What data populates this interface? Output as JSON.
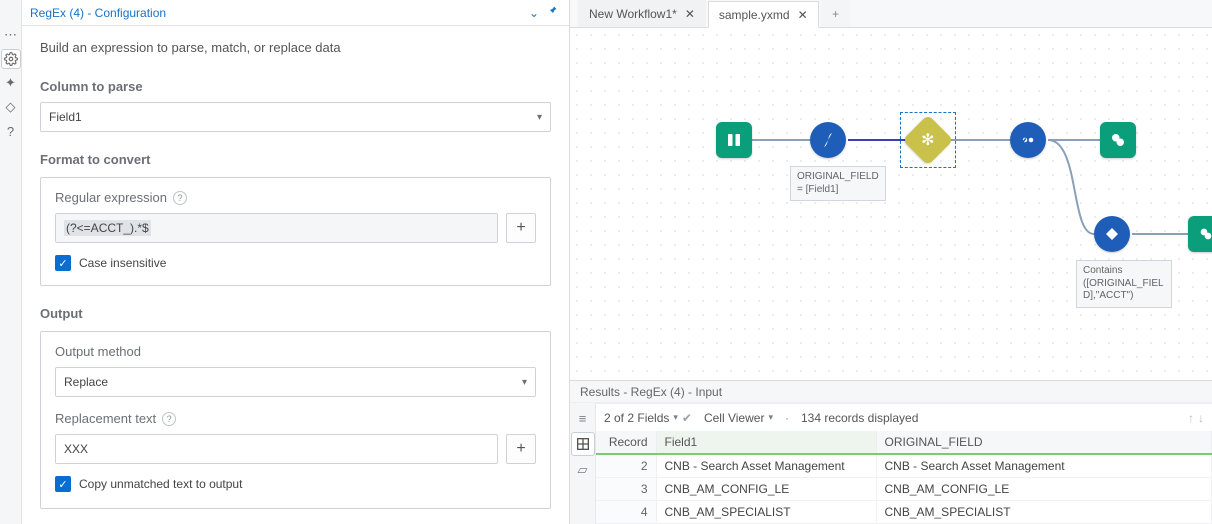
{
  "header": {
    "title": "RegEx (4) - Configuration"
  },
  "lead": "Build an expression to parse, match, or replace data",
  "column_to_parse": {
    "label": "Column to parse",
    "value": "Field1"
  },
  "format_to_convert": {
    "label": "Format to convert"
  },
  "regex": {
    "label": "Regular expression",
    "value": "(?<=ACCT_).*$"
  },
  "case": {
    "label": "Case insensitive",
    "checked": true
  },
  "output_section": {
    "label": "Output"
  },
  "output_method": {
    "label": "Output method",
    "value": "Replace"
  },
  "replacement": {
    "label": "Replacement text",
    "value": "XXX"
  },
  "copy_unmatched": {
    "label": "Copy unmatched text to output",
    "checked": true
  },
  "tabs": {
    "new": "New Workflow1*",
    "sample": "sample.yxmd"
  },
  "canvas": {
    "anno1_line1": "ORIGINAL_FIELD",
    "anno1_line2": "= [Field1]",
    "anno2_line1": "Contains",
    "anno2_line2": "([ORIGINAL_FIEL",
    "anno2_line3": "D],\"ACCT\")"
  },
  "results": {
    "title": "Results - RegEx (4) - Input",
    "fields_summary": "2 of 2 Fields",
    "cell_viewer": "Cell Viewer",
    "records_summary": "134 records displayed",
    "columns": {
      "record": "Record",
      "field1": "Field1",
      "orig": "ORIGINAL_FIELD"
    },
    "rows": [
      {
        "n": "2",
        "f1": "CNB - Search Asset Management",
        "orig": "CNB - Search Asset Management"
      },
      {
        "n": "3",
        "f1": "CNB_AM_CONFIG_LE",
        "orig": "CNB_AM_CONFIG_LE"
      },
      {
        "n": "4",
        "f1": "CNB_AM_SPECIALIST",
        "orig": "CNB_AM_SPECIALIST"
      }
    ]
  }
}
